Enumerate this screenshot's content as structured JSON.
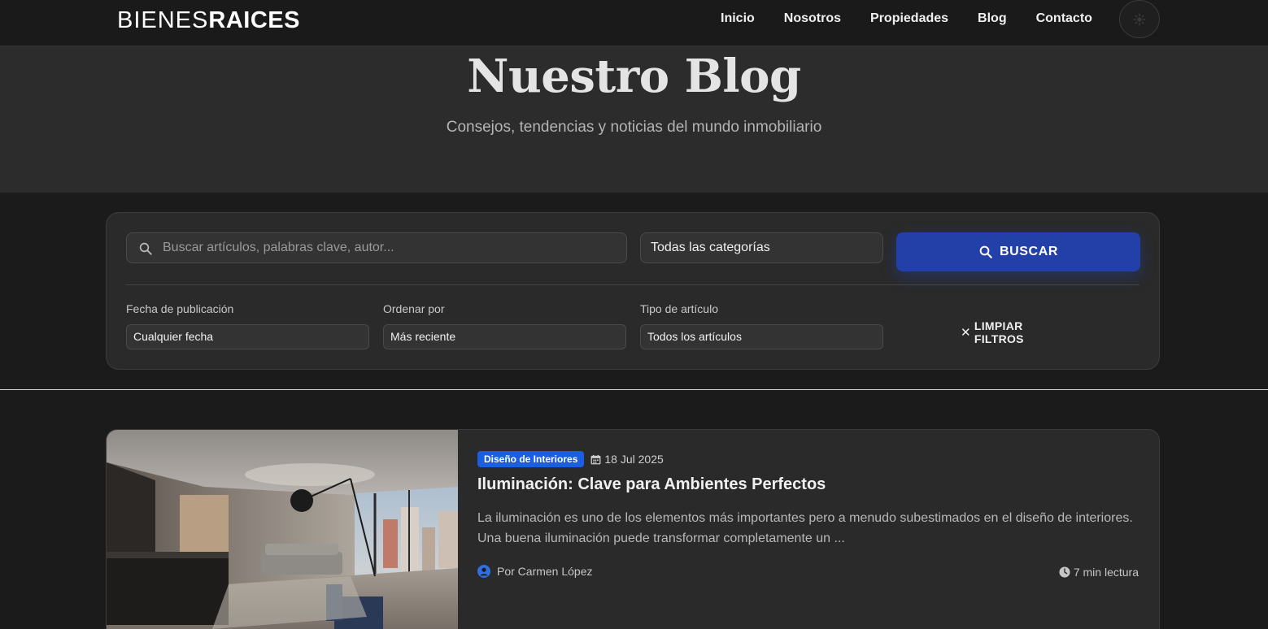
{
  "brand": {
    "logo_thin": "BIENES",
    "logo_bold": "RAICES"
  },
  "nav": {
    "items": [
      "Inicio",
      "Nosotros",
      "Propiedades",
      "Blog",
      "Contacto"
    ]
  },
  "hero": {
    "title": "Nuestro Blog",
    "subtitle": "Consejos, tendencias y noticias del mundo inmobiliario"
  },
  "filters": {
    "search_placeholder": "Buscar artículos, palabras clave, autor...",
    "category_value": "Todas las categorías",
    "search_button": "BUSCAR",
    "date_label": "Fecha de publicación",
    "date_value": "Cualquier fecha",
    "sort_label": "Ordenar por",
    "sort_value": "Más reciente",
    "type_label": "Tipo de artículo",
    "type_value": "Todos los artículos",
    "clear_button": "LIMPIAR FILTROS"
  },
  "articles": [
    {
      "category": "Diseño de Interiores",
      "date": "18 Jul 2025",
      "title": "Iluminación: Clave para Ambientes Perfectos",
      "excerpt": "La iluminación es uno de los elementos más importantes pero a menudo subestimados en el diseño de interiores. Una buena iluminación puede transformar completamente un ...",
      "author": "Por Carmen López",
      "read_time": "7 min lectura"
    }
  ],
  "colors": {
    "accent": "#2340a8",
    "badge": "#1a5fe0",
    "background": "#1b1b1b",
    "card": "#2a2a2a"
  },
  "icons": [
    "gear-icon",
    "search-icon",
    "close-icon",
    "calendar-icon",
    "user-icon",
    "clock-icon"
  ]
}
